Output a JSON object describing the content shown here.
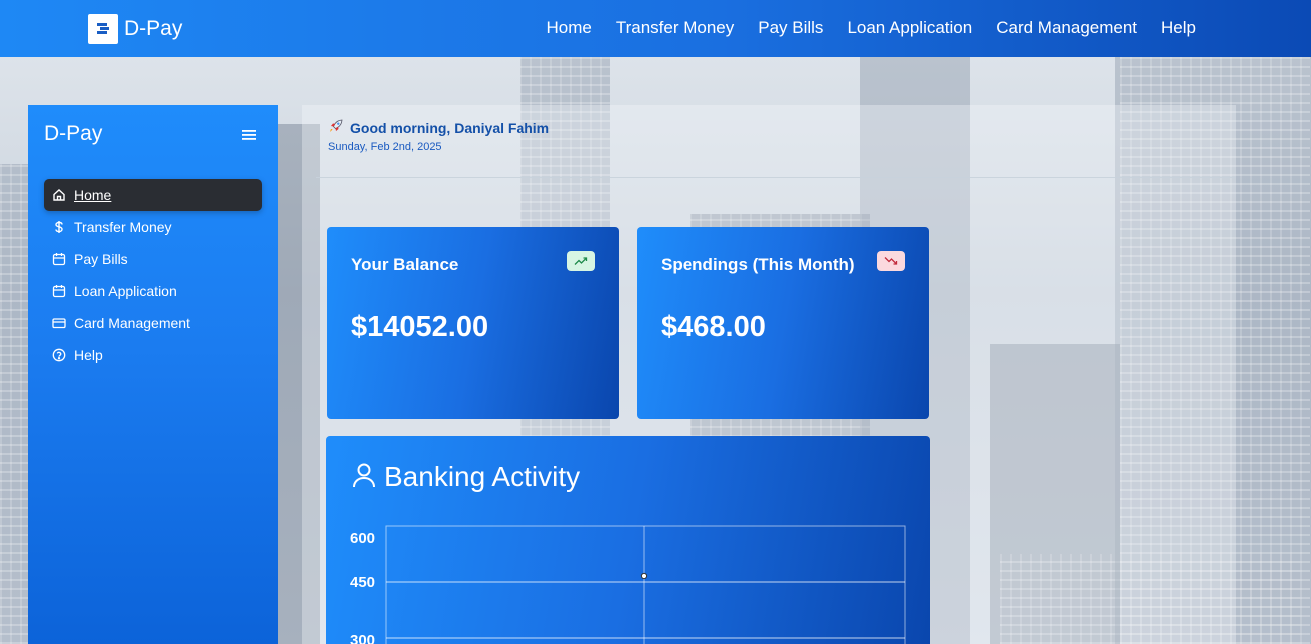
{
  "brand": {
    "name": "D-Pay"
  },
  "topnav": [
    "Home",
    "Transfer Money",
    "Pay Bills",
    "Loan Application",
    "Card Management",
    "Help"
  ],
  "sidebar": {
    "title": "D-Pay",
    "items": [
      {
        "label": "Home",
        "icon": "home-icon",
        "active": true
      },
      {
        "label": "Transfer Money",
        "icon": "dollar-icon",
        "active": false
      },
      {
        "label": "Pay Bills",
        "icon": "calendar-icon",
        "active": false
      },
      {
        "label": "Loan Application",
        "icon": "calendar-icon",
        "active": false
      },
      {
        "label": "Card Management",
        "icon": "credit-card-icon",
        "active": false
      },
      {
        "label": "Help",
        "icon": "help-circle-icon",
        "active": false
      }
    ]
  },
  "greeting": {
    "title": "Good morning, Daniyal Fahim",
    "date": "Sunday, Feb 2nd, 2025",
    "icon": "rocket-icon"
  },
  "cards": {
    "balance": {
      "title": "Your Balance",
      "value": "$14052.00",
      "trend": "up"
    },
    "spendings": {
      "title": "Spendings (This Month)",
      "value": "$468.00",
      "trend": "down"
    }
  },
  "activity": {
    "title": "Banking Activity",
    "icon": "user-icon",
    "y_ticks": [
      "600",
      "450",
      "300"
    ]
  },
  "colors": {
    "accent": "#1a6fe0",
    "dark": "#0b4ab5",
    "active_item": "#2a2d33"
  }
}
